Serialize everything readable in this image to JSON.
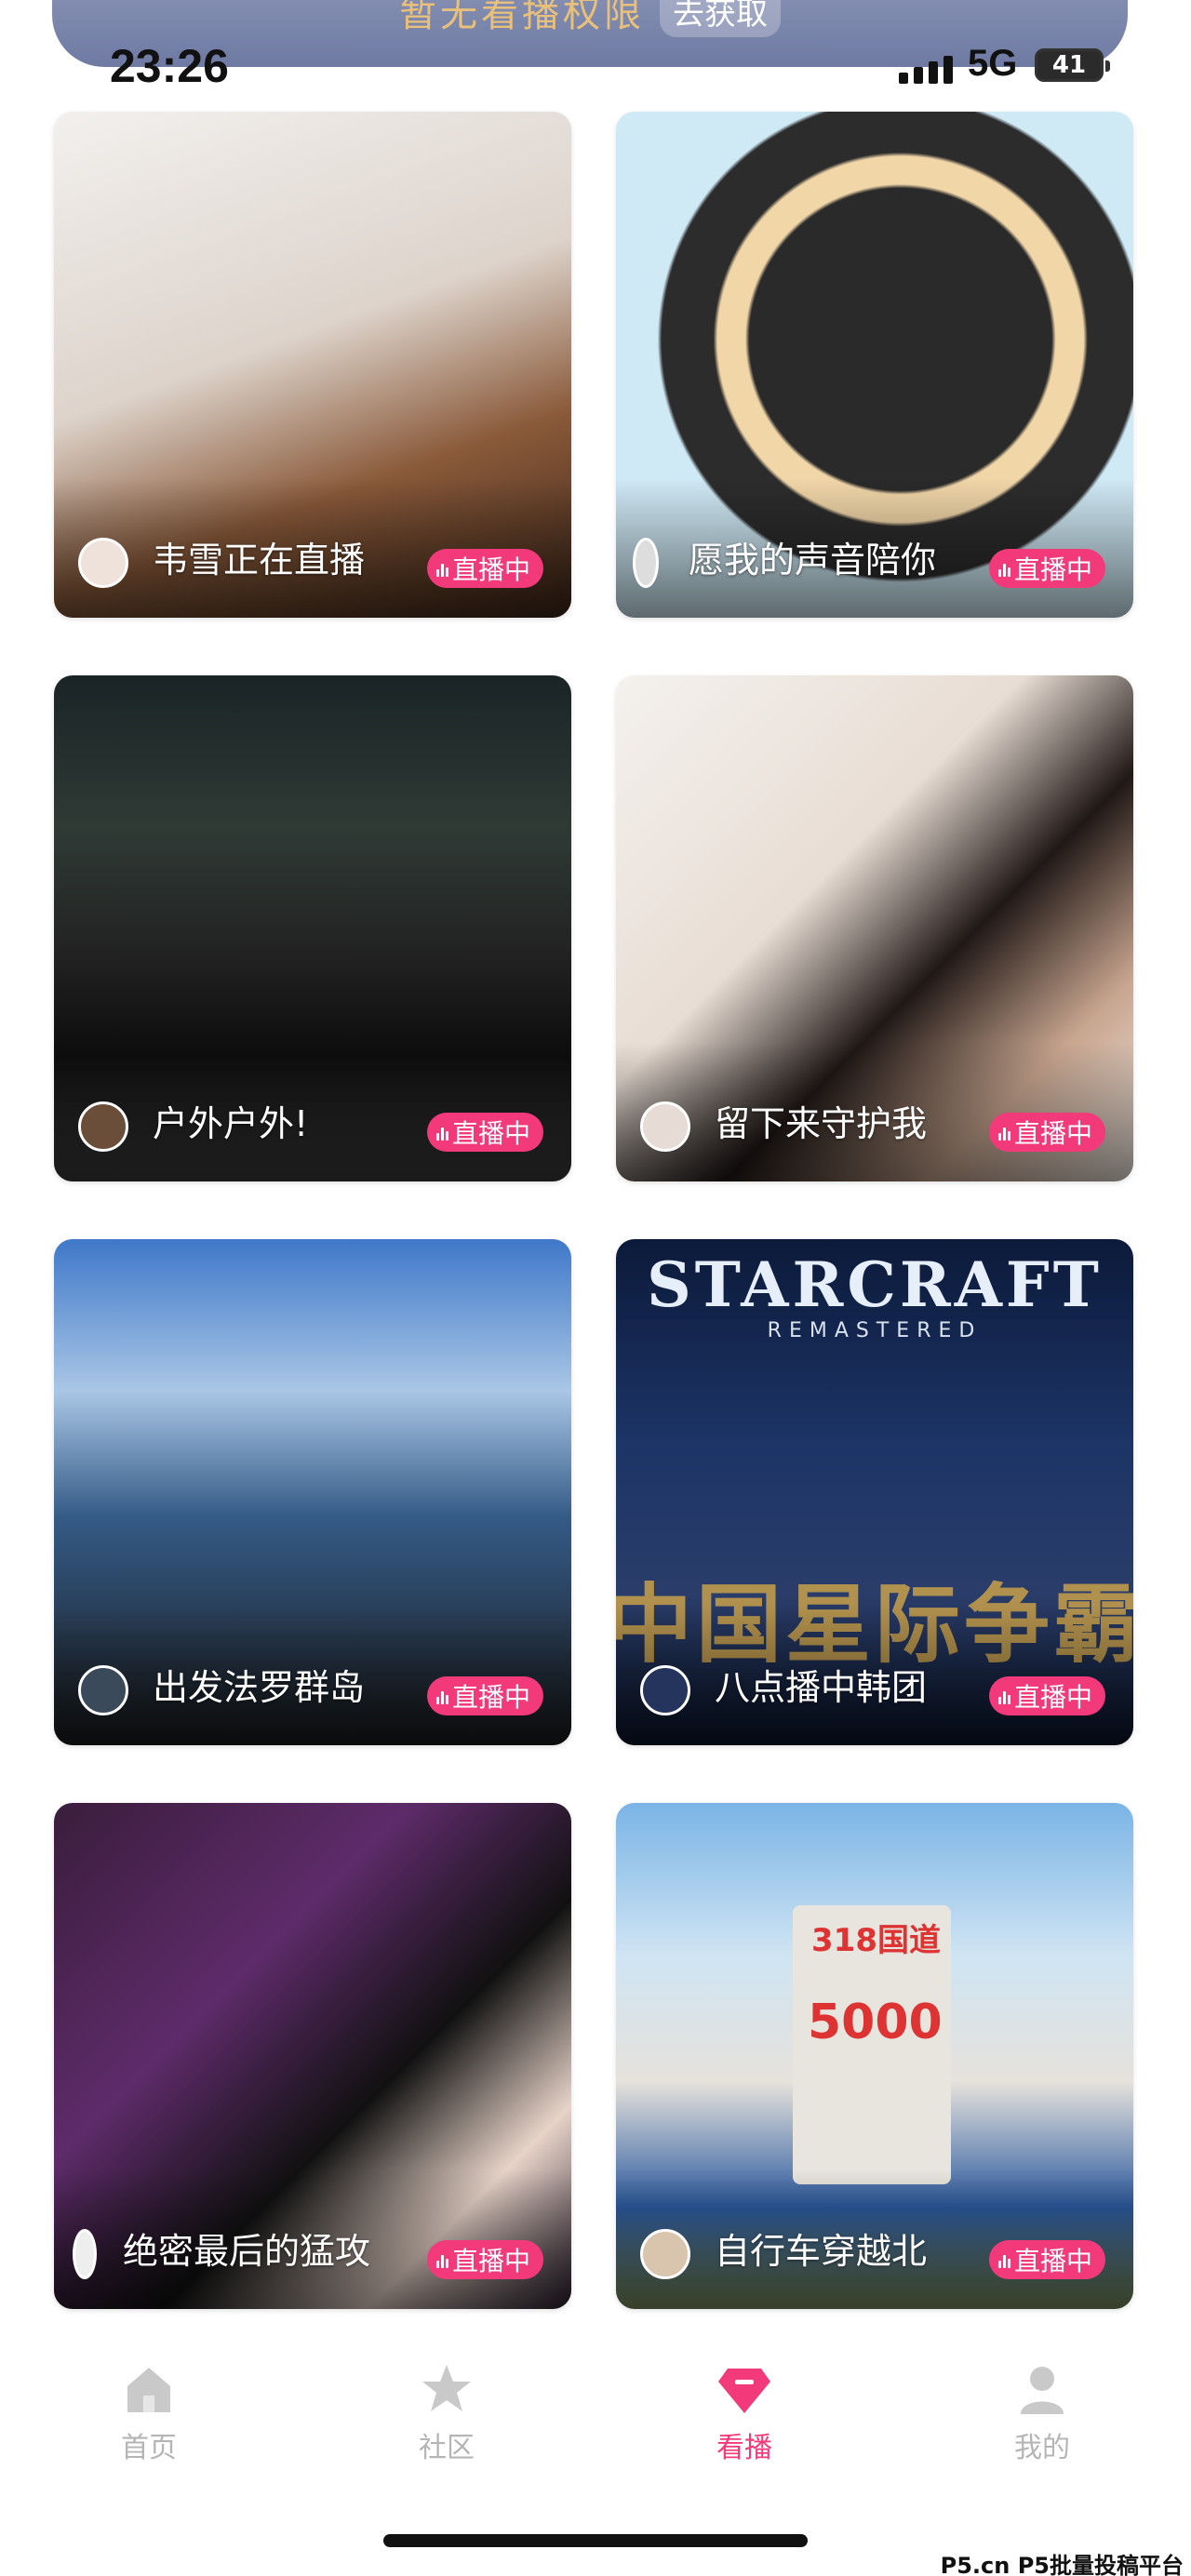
{
  "banner": {
    "text": "暂无看播权限",
    "action": "去获取"
  },
  "status": {
    "time": "23:26",
    "network": "5G",
    "battery": "41"
  },
  "cards": [
    {
      "title": "韦雪正在直播",
      "badge": "直播中"
    },
    {
      "title": "愿我的声音陪你",
      "badge": "直播中"
    },
    {
      "title": "户外户外!",
      "badge": "直播中"
    },
    {
      "title": "留下来守护我",
      "badge": "直播中"
    },
    {
      "title": "出发法罗群岛",
      "badge": "直播中"
    },
    {
      "title": "八点播中韩团",
      "badge": "直播中"
    },
    {
      "title": "绝密最后的猛攻",
      "badge": "直播中"
    },
    {
      "title": "自行车穿越北",
      "badge": "直播中"
    }
  ],
  "thumb_text": {
    "starcraft": "STARCRAFT",
    "starcraft_sub": "REMASTERED",
    "starcraft_overlay": "中国星际争霸",
    "sign_road": "318国道",
    "sign_km": "5000"
  },
  "tabs": [
    {
      "label": "首页",
      "icon": "home-icon"
    },
    {
      "label": "社区",
      "icon": "star-icon"
    },
    {
      "label": "看播",
      "icon": "live-gem-icon",
      "active": true
    },
    {
      "label": "我的",
      "icon": "profile-icon"
    }
  ],
  "colors": {
    "accent": "#f23a7b",
    "tab_inactive": "#b5b5b5",
    "banner_bg": "#7f89ad",
    "banner_text": "#e8c07a"
  },
  "watermark": "P5.cn P5批量投稿平台"
}
